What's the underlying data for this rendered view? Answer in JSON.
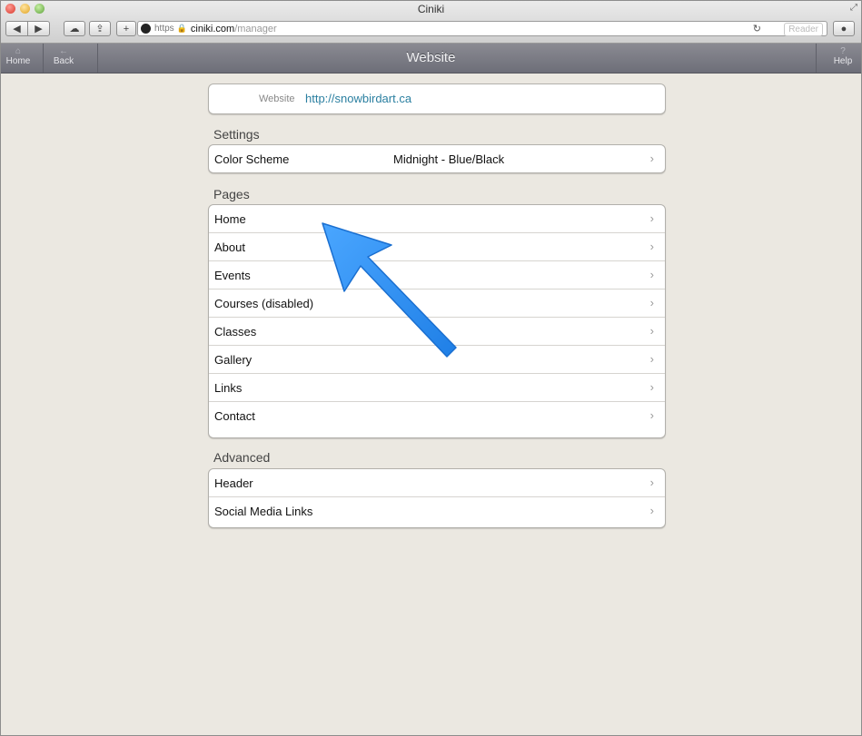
{
  "browser": {
    "window_title": "Ciniki",
    "url_scheme": "https",
    "url_domain": "ciniki.com",
    "url_path": "/manager",
    "reader_label": "Reader",
    "reload_icon": "reload-icon"
  },
  "app_toolbar": {
    "title": "Website",
    "home_label": "Home",
    "back_label": "Back",
    "help_label": "Help",
    "help_icon_text": "?"
  },
  "website": {
    "label": "Website",
    "url": "http://snowbirdart.ca"
  },
  "settings": {
    "heading": "Settings",
    "items": [
      {
        "label": "Color Scheme",
        "value": "Midnight - Blue/Black"
      }
    ]
  },
  "pages": {
    "heading": "Pages",
    "items": [
      {
        "label": "Home"
      },
      {
        "label": "About"
      },
      {
        "label": "Events"
      },
      {
        "label": "Courses (disabled)"
      },
      {
        "label": "Classes"
      },
      {
        "label": "Gallery"
      },
      {
        "label": "Links"
      },
      {
        "label": "Contact"
      }
    ]
  },
  "advanced": {
    "heading": "Advanced",
    "items": [
      {
        "label": "Header"
      },
      {
        "label": "Social Media Links"
      }
    ]
  },
  "chevron": "›",
  "colors": {
    "toolbar": "#7b7c85",
    "link": "#2a7fa0",
    "annotation_arrow": "#2e8ef0",
    "background": "#ebe8e1"
  }
}
